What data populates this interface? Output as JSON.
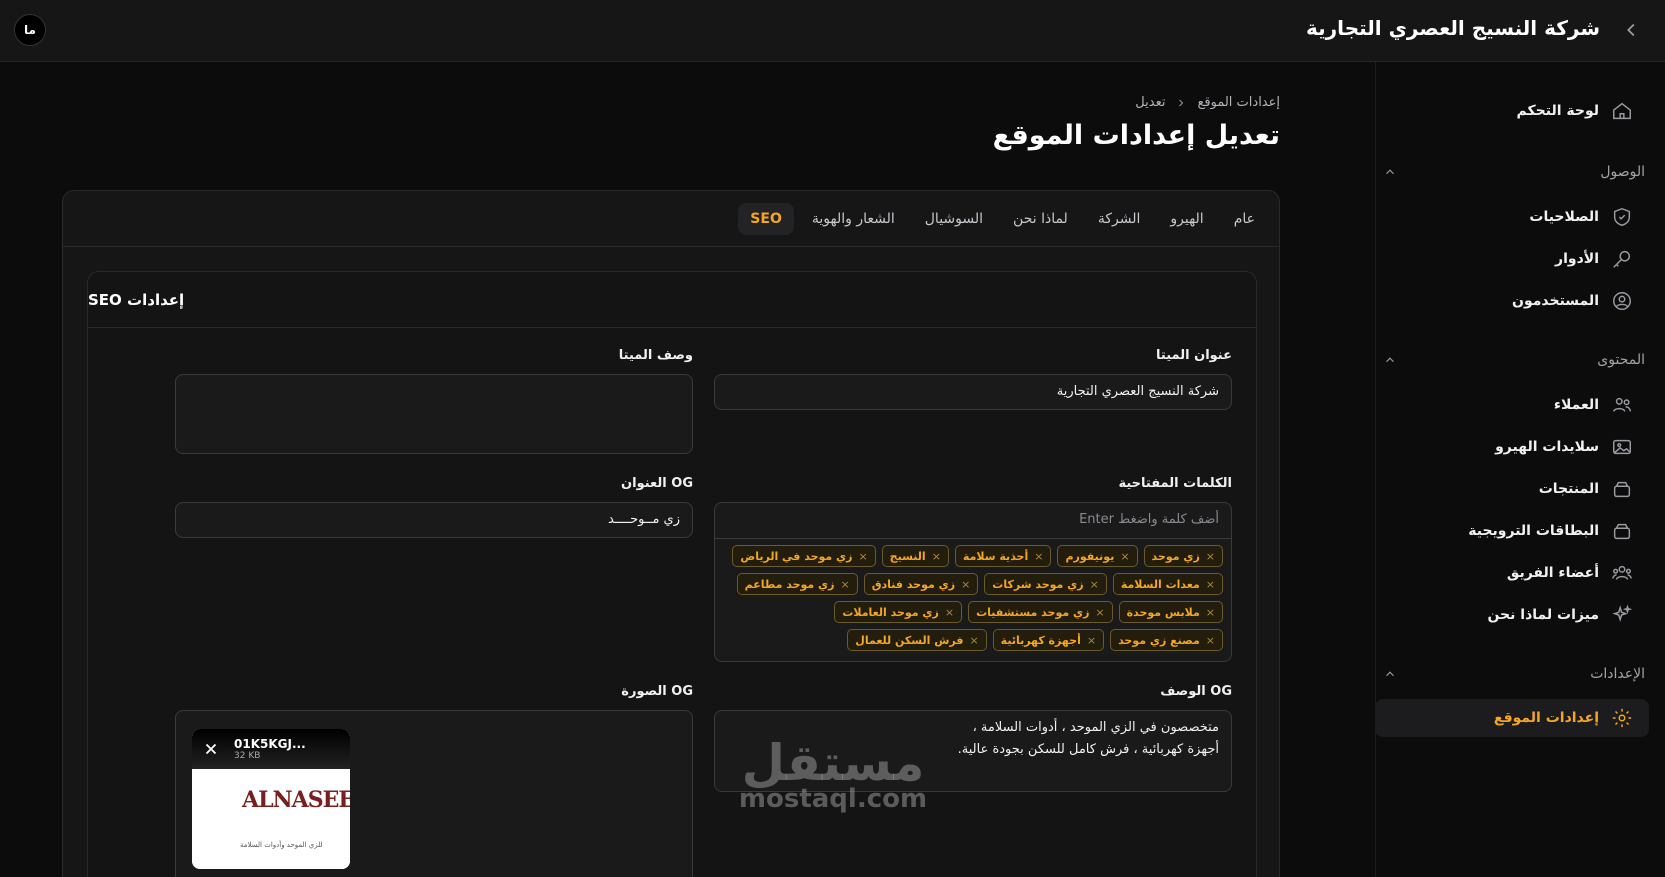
{
  "topbar": {
    "avatar_initials": "ما",
    "brand": "شركة النسيج العصري التجارية"
  },
  "sidebar": {
    "dashboard": "لوحة التحكم",
    "groups": [
      {
        "label": "الوصول",
        "items": [
          "الصلاحيات",
          "الأدوار",
          "المستخدمون"
        ]
      },
      {
        "label": "المحتوى",
        "items": [
          "العملاء",
          "سلايدات الهيرو",
          "المنتجات",
          "البطاقات الترويجية",
          "أعضاء الفريق",
          "ميزات لماذا نحن"
        ]
      },
      {
        "label": "الإعدادات",
        "items": [
          "إعدادات الموقع"
        ]
      }
    ]
  },
  "breadcrumb": {
    "parent": "إعدادات الموقع",
    "current": "تعديل"
  },
  "page_title": "تعديل إعدادات الموقع",
  "tabs": [
    "عام",
    "الهيرو",
    "الشركة",
    "لماذا نحن",
    "السوشيال",
    "الشعار والهوية",
    "SEO"
  ],
  "active_tab": "SEO",
  "seo": {
    "heading": "إعدادات SEO",
    "meta_title_label": "عنوان الميتا",
    "meta_title_value": "شركة النسيج العصري التجارية",
    "meta_desc_label": "وصف الميتا",
    "meta_desc_value": "",
    "keywords_label": "الكلمات المفتاحية",
    "keywords_placeholder": "أضف كلمة واضغط Enter",
    "keywords": [
      "زي موحد",
      "يونيفورم",
      "أحذية سلامة",
      "النسيج",
      "زي موحد في الرياض",
      "معدات السلامة",
      "زي موحد شركات",
      "زي موحد فنادق",
      "زي موحد مطاعم",
      "ملابس موحدة",
      "زي موحد مستشفيات",
      "زي موحد العاملات",
      "مصنع زي موحد",
      "أجهزة كهربائية",
      "فرش السكن للعمال"
    ],
    "og_title_label": "OG العنوان",
    "og_title_value": "زي مــوحــــد",
    "og_desc_label": "OG الوصف",
    "og_desc_line1": "متخصصون في الزي الموحد ، أدوات السلامة ،",
    "og_desc_line2": "أجهزة كهربائية ، فرش كامل للسكن بجودة عالية.",
    "og_image_label": "OG الصورة",
    "og_image_name": "01K5KGJ...",
    "og_image_size": "32 KB",
    "logo_text": "ALNASEEJ",
    "logo_sub": "للزي الموحد وأدوات السلامة"
  },
  "watermark": {
    "ar": "مستقل",
    "en": "mostaql.com"
  },
  "colors": {
    "accent": "#f5a623",
    "background": "#0c0c0d",
    "surface": "#161617"
  }
}
